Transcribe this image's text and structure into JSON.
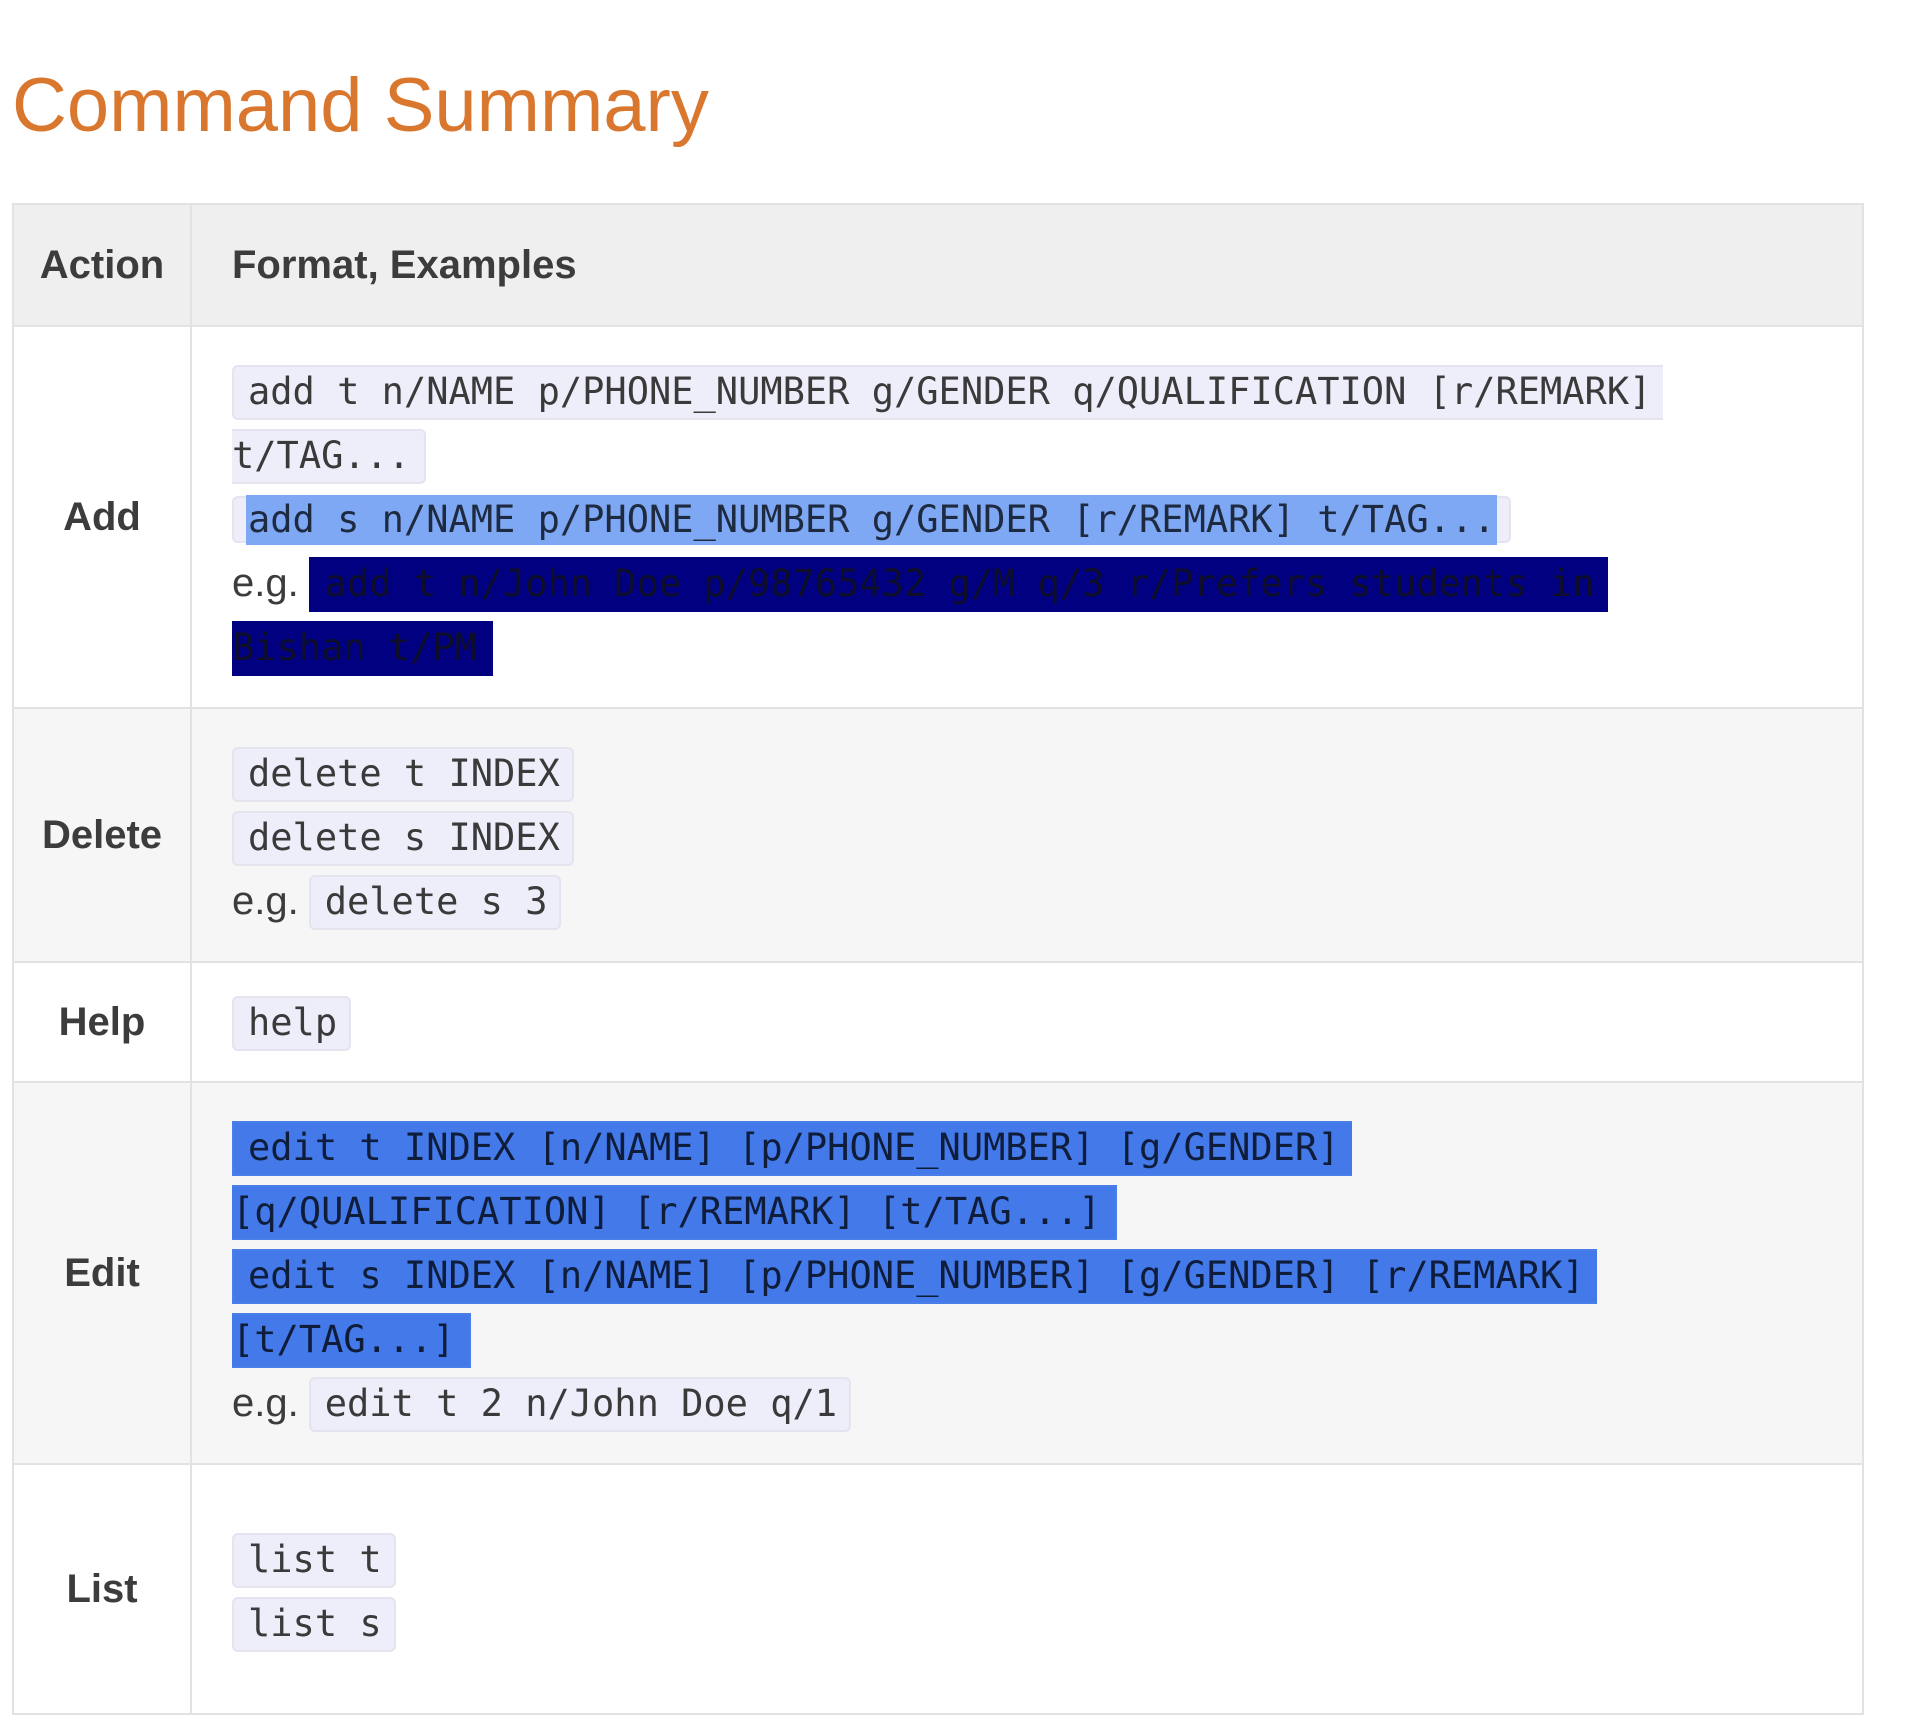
{
  "page": {
    "title": "Command Summary"
  },
  "table": {
    "headers": {
      "action": "Action",
      "format": "Format, Examples"
    },
    "rows": {
      "add": {
        "action": "Add",
        "format_t_line1": "add t n/NAME p/PHONE_NUMBER g/GENDER q/QUALIFICATION [r/REMARK]",
        "format_t_line2": "t/TAG...",
        "format_s": "add s n/NAME p/PHONE_NUMBER g/GENDER [r/REMARK] t/TAG...",
        "eg_label": "e.g.",
        "example_line1": "add t n/John Doe p/98765432 g/M q/3 r/Prefers students in",
        "example_line2": "Bishan t/PM"
      },
      "delete": {
        "action": "Delete",
        "format_t": "delete t INDEX",
        "format_s": "delete s INDEX",
        "eg_label": "e.g.",
        "example": "delete s 3"
      },
      "help": {
        "action": "Help",
        "format": "help"
      },
      "edit": {
        "action": "Edit",
        "format_t_line1": "edit t INDEX [n/NAME] [p/PHONE_NUMBER] [g/GENDER]",
        "format_t_line2": "[q/QUALIFICATION] [r/REMARK] [t/TAG...]",
        "format_s_line1": "edit s INDEX [n/NAME] [p/PHONE_NUMBER] [g/GENDER] [r/REMARK]",
        "format_s_line2": "[t/TAG...]",
        "eg_label": "e.g.",
        "example": "edit t 2 n/John Doe q/1"
      },
      "list": {
        "action": "List",
        "format_t": "list t",
        "format_s": "list s"
      }
    }
  },
  "colors": {
    "title": "#d9772f",
    "code_bg": "#eeeefb",
    "selection_light": "#7ea8f4",
    "selection_dark": "#000080",
    "selection_blue": "#4479ea"
  }
}
